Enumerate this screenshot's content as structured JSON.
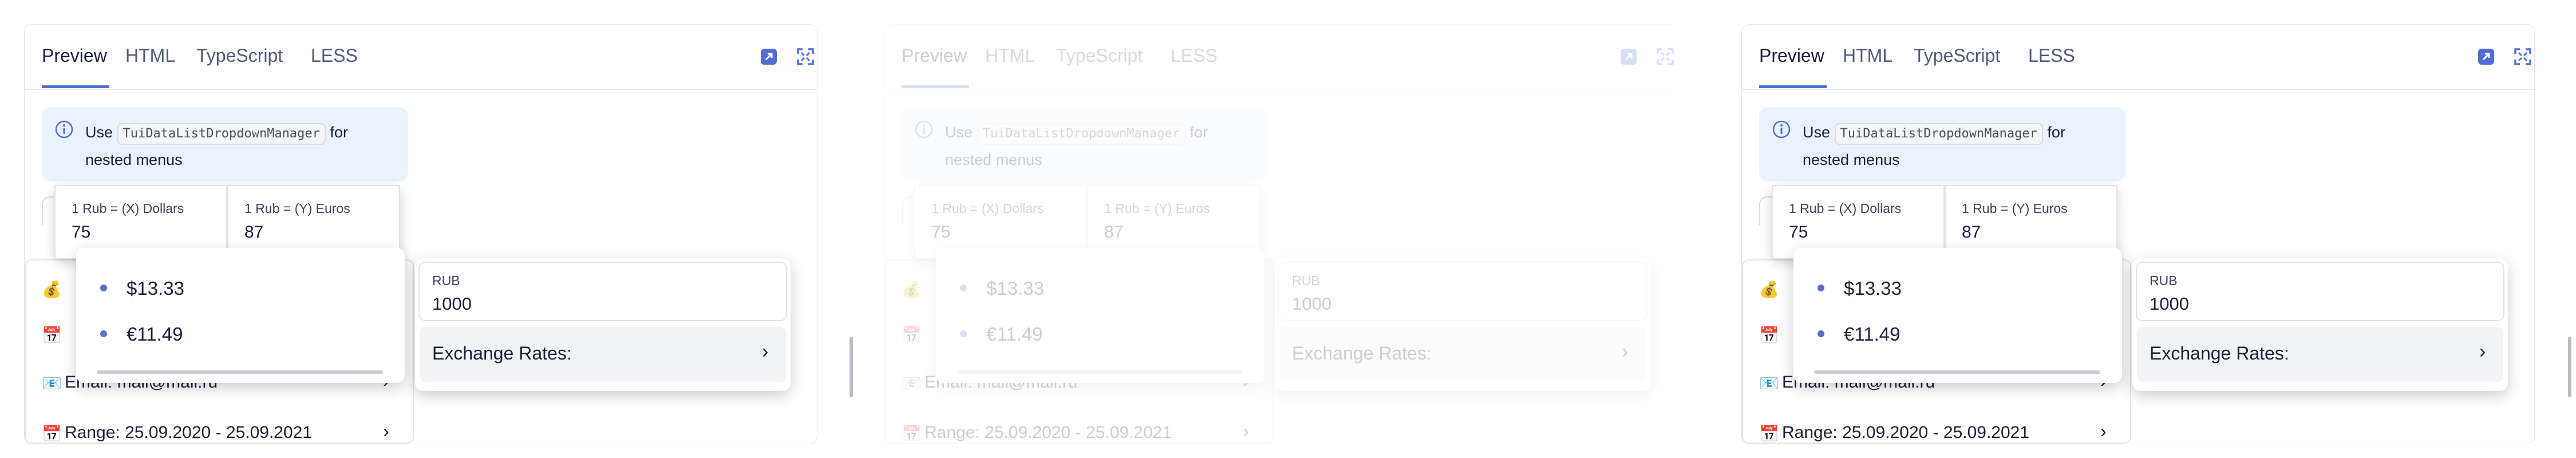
{
  "tabs": [
    "Preview",
    "HTML",
    "TypeScript",
    "LESS"
  ],
  "toolbar": {
    "icons": [
      "open-in-new-icon",
      "fullscreen-icon"
    ]
  },
  "notice": {
    "pre": "Use",
    "code": "TuiDataListDropdownManager",
    "post": "for",
    "line2": "nested menus"
  },
  "rates": [
    {
      "label": "1 Rub = (X) Dollars",
      "value": "75"
    },
    {
      "label": "1 Rub = (Y) Euros",
      "value": "87"
    }
  ],
  "currency_items": [
    "$13.33",
    "€11.49"
  ],
  "submenu": {
    "rub_label": "RUB",
    "rub_value": "1000",
    "exchange_label": "Exchange Rates:"
  },
  "list_items": [
    {
      "emoji": "💰",
      "text": ""
    },
    {
      "emoji": "📅",
      "text": ""
    },
    {
      "emoji": "📧",
      "text": "Email: mail@mail.ru"
    },
    {
      "emoji": "📅",
      "text": "Range: 25.09.2020 - 25.09.2021"
    }
  ],
  "colors": {
    "accent": "#526ed3",
    "notice_bg": "#eaf2fd",
    "dot": "#5970c8"
  }
}
